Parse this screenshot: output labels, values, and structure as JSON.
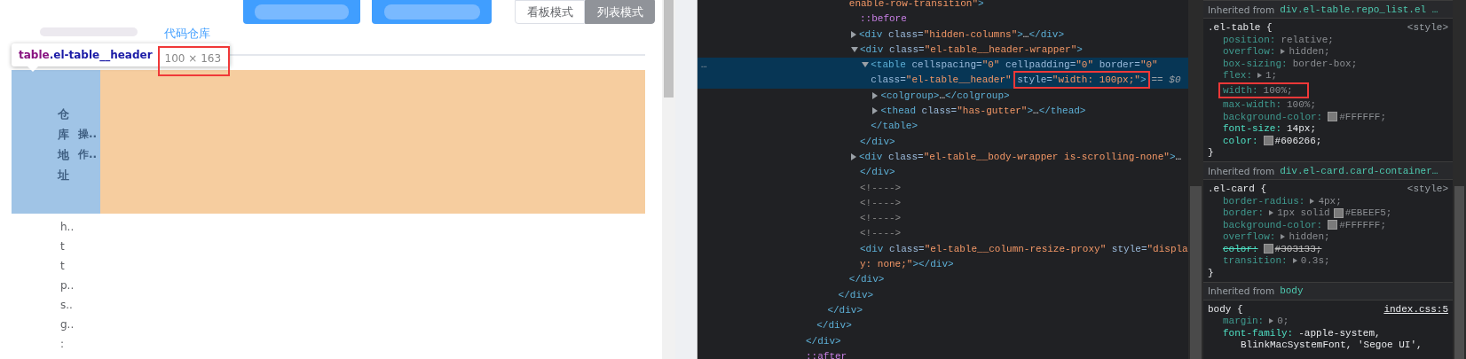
{
  "page": {
    "view_toggle": [
      {
        "label": "看板模式",
        "selected": false
      },
      {
        "label": "列表模式",
        "selected": true
      }
    ],
    "tabs": [
      {
        "label": "代码仓库",
        "selected": true
      }
    ],
    "inspect_tooltip": [
      {
        "kind": "tag",
        "text": "table"
      },
      {
        "kind": "class",
        "text": ".el-table__header"
      },
      {
        "kind": "framed-size",
        "text": "100 × 163"
      }
    ],
    "header_columns": [
      {
        "kind": "vertical",
        "label": "仓库地址"
      },
      {
        "kind": "lines",
        "lines": [
          "操..",
          "作.."
        ]
      }
    ],
    "body_column": [
      "h..",
      "t",
      "t",
      "p..",
      "s..",
      "g..",
      ":"
    ]
  },
  "elements": {
    "tree": [
      {
        "close": "</div>",
        "children": [
          {
            "close": "</div>",
            "children": [
              {
                "close": "</div>",
                "children": [
                  {
                    "close": "</div>",
                    "children": [
                      {
                        "open": [
                          [
                            {
                              "kind": "val",
                              "text": "enable-row-transition\""
                            },
                            {
                              "kind": "tag",
                              "text": ">"
                            }
                          ]
                        ],
                        "close": "</div>",
                        "children": [
                          {
                            "open": [
                              [
                                {
                                  "kind": "pseudo",
                                  "text": "::before"
                                }
                              ]
                            ]
                          },
                          {
                            "expanded": false,
                            "open": [
                              [
                                {
                                  "kind": "tag",
                                  "text": "<div"
                                },
                                {
                                  "kind": "attr",
                                  "text": " class"
                                },
                                {
                                  "kind": "eq",
                                  "text": "="
                                },
                                {
                                  "kind": "val",
                                  "text": "\"hidden-columns\""
                                },
                                {
                                  "kind": "tag",
                                  "text": ">"
                                },
                                {
                                  "kind": "plain",
                                  "text": "…"
                                },
                                {
                                  "kind": "tag",
                                  "text": "</div>"
                                }
                              ]
                            ]
                          },
                          {
                            "expanded": true,
                            "open": [
                              [
                                {
                                  "kind": "tag",
                                  "text": "<div"
                                },
                                {
                                  "kind": "attr",
                                  "text": " class"
                                },
                                {
                                  "kind": "eq",
                                  "text": "="
                                },
                                {
                                  "kind": "val",
                                  "text": "\"el-table__header-wrapper\""
                                },
                                {
                                  "kind": "tag",
                                  "text": ">"
                                }
                              ]
                            ],
                            "close": "</div>",
                            "children": [
                              {
                                "expanded": true,
                                "selected": true,
                                "row_menu": "…",
                                "ref": "== $0",
                                "open": [
                                  [
                                    {
                                      "kind": "tag",
                                      "text": "<table"
                                    },
                                    {
                                      "kind": "attr",
                                      "text": " cellspacing"
                                    },
                                    {
                                      "kind": "eq",
                                      "text": "="
                                    },
                                    {
                                      "kind": "val",
                                      "text": "\"0\""
                                    },
                                    {
                                      "kind": "attr",
                                      "text": " cellpadding"
                                    },
                                    {
                                      "kind": "eq",
                                      "text": "="
                                    },
                                    {
                                      "kind": "val",
                                      "text": "\"0\""
                                    },
                                    {
                                      "kind": "attr",
                                      "text": " border"
                                    },
                                    {
                                      "kind": "eq",
                                      "text": "="
                                    },
                                    {
                                      "kind": "val",
                                      "text": "\"0\""
                                    }
                                  ],
                                  [
                                    {
                                      "kind": "attr",
                                      "text": "class"
                                    },
                                    {
                                      "kind": "eq",
                                      "text": "="
                                    },
                                    {
                                      "kind": "val",
                                      "text": "\"el-table__header\""
                                    },
                                    {
                                      "kind": "framed",
                                      "parts": [
                                        {
                                          "kind": "attr",
                                          "text": "style"
                                        },
                                        {
                                          "kind": "eq",
                                          "text": "="
                                        },
                                        {
                                          "kind": "val",
                                          "text": "\"width: 100px;\""
                                        },
                                        {
                                          "kind": "tag",
                                          "text": ">"
                                        }
                                      ]
                                    }
                                  ]
                                ],
                                "close": "</table>",
                                "children": [
                                  {
                                    "expanded": false,
                                    "open": [
                                      [
                                        {
                                          "kind": "tag",
                                          "text": "<colgroup>"
                                        },
                                        {
                                          "kind": "plain",
                                          "text": "…"
                                        },
                                        {
                                          "kind": "tag",
                                          "text": "</colgroup>"
                                        }
                                      ]
                                    ]
                                  },
                                  {
                                    "expanded": false,
                                    "open": [
                                      [
                                        {
                                          "kind": "tag",
                                          "text": "<thead"
                                        },
                                        {
                                          "kind": "attr",
                                          "text": " class"
                                        },
                                        {
                                          "kind": "eq",
                                          "text": "="
                                        },
                                        {
                                          "kind": "val",
                                          "text": "\"has-gutter\""
                                        },
                                        {
                                          "kind": "tag",
                                          "text": ">"
                                        },
                                        {
                                          "kind": "plain",
                                          "text": "…"
                                        },
                                        {
                                          "kind": "tag",
                                          "text": "</thead>"
                                        }
                                      ]
                                    ]
                                  }
                                ]
                              }
                            ]
                          },
                          {
                            "expanded": false,
                            "open": [
                              [
                                {
                                  "kind": "tag",
                                  "text": "<div"
                                },
                                {
                                  "kind": "attr",
                                  "text": " class"
                                },
                                {
                                  "kind": "eq",
                                  "text": "="
                                },
                                {
                                  "kind": "val",
                                  "text": "\"el-table__body-wrapper is-scrolling-none\""
                                },
                                {
                                  "kind": "tag",
                                  "text": ">"
                                },
                                {
                                  "kind": "plain",
                                  "text": "…"
                                }
                              ],
                              [
                                {
                                  "kind": "tag",
                                  "text": "</div>"
                                }
                              ]
                            ]
                          },
                          {
                            "open": [
                              [
                                {
                                  "kind": "comment",
                                  "text": "<!---->"
                                }
                              ]
                            ]
                          },
                          {
                            "open": [
                              [
                                {
                                  "kind": "comment",
                                  "text": "<!---->"
                                }
                              ]
                            ]
                          },
                          {
                            "open": [
                              [
                                {
                                  "kind": "comment",
                                  "text": "<!---->"
                                }
                              ]
                            ]
                          },
                          {
                            "open": [
                              [
                                {
                                  "kind": "comment",
                                  "text": "<!---->"
                                }
                              ]
                            ]
                          },
                          {
                            "open": [
                              [
                                {
                                  "kind": "tag",
                                  "text": "<div"
                                },
                                {
                                  "kind": "attr",
                                  "text": " class"
                                },
                                {
                                  "kind": "eq",
                                  "text": "="
                                },
                                {
                                  "kind": "val",
                                  "text": "\"el-table__column-resize-proxy\""
                                },
                                {
                                  "kind": "attr",
                                  "text": " style"
                                },
                                {
                                  "kind": "eq",
                                  "text": "="
                                },
                                {
                                  "kind": "val",
                                  "text": "\"displa"
                                }
                              ],
                              [
                                {
                                  "kind": "val",
                                  "text": "y: none;\""
                                },
                                {
                                  "kind": "tag",
                                  "text": "></div>"
                                }
                              ]
                            ]
                          }
                        ]
                      }
                    ]
                  }
                ]
              }
            ]
          }
        ]
      },
      {
        "open": [
          [
            {
              "kind": "pseudo",
              "text": "::after"
            }
          ]
        ]
      }
    ]
  },
  "styles": {
    "sections": [
      {
        "kind": "inherited",
        "label": "Inherited from",
        "selector": "div.el-table.repo_list.el …"
      },
      {
        "kind": "rule",
        "selector": ".el-table {",
        "source": "<style>",
        "source_link": false,
        "close": "}",
        "declarations": [
          {
            "kind": "plain",
            "prop": "position:",
            "value": "relative;",
            "active": false,
            "struck": false
          },
          {
            "kind": "toggle",
            "prop": "overflow:",
            "value": "hidden;",
            "active": false,
            "struck": false
          },
          {
            "kind": "plain",
            "prop": "box-sizing:",
            "value": "border-box;",
            "active": false,
            "struck": false
          },
          {
            "kind": "toggle",
            "prop": "flex:",
            "value": "1;",
            "active": false,
            "struck": false
          },
          {
            "kind": "framed",
            "prop": "width:",
            "value": "100%;",
            "active": false,
            "struck": false
          },
          {
            "kind": "plain",
            "prop": "max-width:",
            "value": "100%;",
            "active": false,
            "struck": false
          },
          {
            "kind": "color",
            "prop": "background-color:",
            "value": "#FFFFFF;",
            "active": false,
            "struck": false
          },
          {
            "kind": "plain",
            "prop": "font-size:",
            "value": "14px;",
            "active": true,
            "struck": false
          },
          {
            "kind": "color",
            "prop": "color:",
            "value": "#606266;",
            "active": true,
            "struck": false
          }
        ]
      },
      {
        "kind": "inherited",
        "label": "Inherited from",
        "selector": "div.el-card.card-container…"
      },
      {
        "kind": "rule",
        "selector": ".el-card {",
        "source": "<style>",
        "source_link": false,
        "close": "}",
        "declarations": [
          {
            "kind": "toggle",
            "prop": "border-radius:",
            "value": "4px;",
            "active": false,
            "struck": false
          },
          {
            "kind": "toggle-color",
            "prop": "border:",
            "value_pre": "1px solid",
            "value": "#EBEEF5;",
            "active": false,
            "struck": false
          },
          {
            "kind": "color",
            "prop": "background-color:",
            "value": "#FFFFFF;",
            "active": false,
            "struck": false
          },
          {
            "kind": "toggle",
            "prop": "overflow:",
            "value": "hidden;",
            "active": false,
            "struck": false
          },
          {
            "kind": "color",
            "prop": "color:",
            "value": "#303133;",
            "active": false,
            "struck": true
          },
          {
            "kind": "toggle",
            "prop": "transition:",
            "value": "0.3s;",
            "active": false,
            "struck": false
          }
        ]
      },
      {
        "kind": "inherited",
        "label": "Inherited from",
        "selector": "body"
      },
      {
        "kind": "rule",
        "selector": "body {",
        "source": "index.css:5",
        "source_link": true,
        "declarations": [
          {
            "kind": "toggle",
            "prop": "margin:",
            "value": "0;",
            "active": false,
            "struck": false
          },
          {
            "kind": "plain",
            "prop": "font-family:",
            "value": "-apple-system,",
            "value_more": "BlinkMacSystemFont, 'Segoe UI',",
            "active": true,
            "struck": false
          }
        ]
      }
    ]
  }
}
